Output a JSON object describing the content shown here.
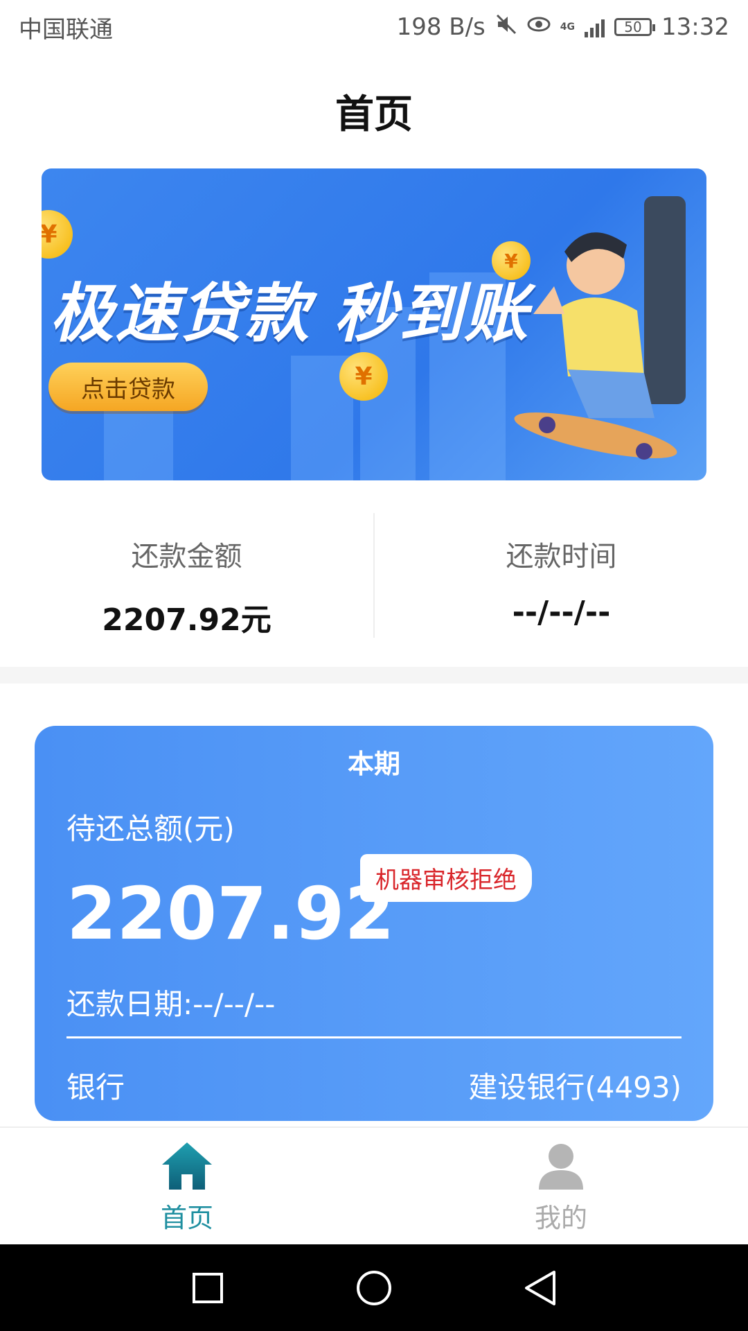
{
  "status_bar": {
    "carrier": "中国联通",
    "speed": "198 B/s",
    "network": "4G",
    "battery": "50",
    "time": "13:32"
  },
  "header": {
    "title": "首页"
  },
  "banner": {
    "headline": "极速贷款 秒到账",
    "button_label": "点击贷款",
    "coin_symbol": "¥"
  },
  "repayment_summary": {
    "amount_label": "还款金额",
    "amount_value": "2207.92元",
    "time_label": "还款时间",
    "time_value": "--/--/--"
  },
  "current_period": {
    "title": "本期",
    "due_label": "待还总额(元)",
    "due_amount": "2207.92",
    "status_badge": "机器审核拒绝",
    "due_date": "还款日期:--/--/--",
    "bank_label": "银行",
    "bank_value": "建设银行(4493)"
  },
  "bottom_nav": {
    "items": [
      {
        "label": "首页",
        "icon": "home-icon",
        "active": true
      },
      {
        "label": "我的",
        "icon": "user-icon",
        "active": false
      }
    ]
  },
  "colors": {
    "accent": "#1f8fa0",
    "card_blue": "#4a90f4",
    "badge_red": "#d9262b"
  }
}
